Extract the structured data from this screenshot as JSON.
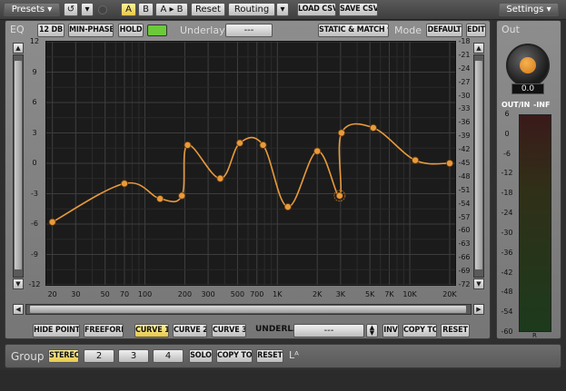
{
  "topbar": {
    "presets_label": "Presets",
    "a_label": "A",
    "b_label": "B",
    "ab_label": "A ▸ B",
    "reset_label": "Reset",
    "routing_label": "Routing",
    "load_csv_label": "LOAD CSV",
    "save_csv_label": "SAVE CSV",
    "settings_label": "Settings"
  },
  "eq": {
    "section_label": "EQ",
    "range_label": "12 DB",
    "min_phase_label": "MIN-PHASE",
    "hold_label": "HOLD",
    "underlay_label": "Underlay",
    "underlay_value": "---",
    "static_match_label": "STATIC & MATCH",
    "mode_label": "Mode",
    "default_label": "DEFAULT",
    "edit_label": "EDIT",
    "accent_color": "#e89a3c",
    "led_color": "#6cc93a"
  },
  "chart_data": {
    "type": "line",
    "x_scale": "log",
    "xlim": [
      18,
      22000
    ],
    "ylim": [
      -12,
      12
    ],
    "right_ylim": [
      -72,
      -18
    ],
    "x_ticks": [
      20,
      30,
      50,
      70,
      100,
      200,
      300,
      500,
      700,
      1000,
      2000,
      3000,
      5000,
      7000,
      10000,
      20000
    ],
    "x_tick_labels": [
      "20",
      "30",
      "50",
      "70",
      "100",
      "200",
      "300",
      "500",
      "700",
      "1K",
      "2K",
      "3K",
      "5K",
      "7K",
      "10K",
      "20K"
    ],
    "left_ticks": [
      12,
      9,
      6,
      3,
      0,
      -3,
      -6,
      -9,
      -12
    ],
    "right_ticks": [
      -18,
      -21,
      -24,
      -27,
      -30,
      -33,
      -36,
      -39,
      -42,
      -45,
      -48,
      -51,
      -54,
      -57,
      -60,
      -63,
      -66,
      -69,
      -72
    ],
    "grid": true,
    "points": [
      {
        "x": 20,
        "y": -5.8
      },
      {
        "x": 70,
        "y": -2.0
      },
      {
        "x": 130,
        "y": -3.5
      },
      {
        "x": 190,
        "y": -3.2
      },
      {
        "x": 210,
        "y": 1.8
      },
      {
        "x": 370,
        "y": -1.5
      },
      {
        "x": 520,
        "y": 2.0
      },
      {
        "x": 780,
        "y": 1.8
      },
      {
        "x": 1200,
        "y": -4.3
      },
      {
        "x": 2000,
        "y": 1.2
      },
      {
        "x": 2950,
        "y": -3.2
      },
      {
        "x": 3050,
        "y": 3.0
      },
      {
        "x": 5300,
        "y": 3.5
      },
      {
        "x": 11000,
        "y": 0.3
      },
      {
        "x": 20000,
        "y": 0.0
      }
    ]
  },
  "curve_controls": {
    "hide_points_label": "HIDE POINTS",
    "freeform_label": "FREEFORM",
    "curve1_label": "CURVE 1",
    "curve2_label": "CURVE 2",
    "curve3_label": "CURVE 3",
    "underlay_label": "UNDERLAY",
    "underlay_value": "---",
    "inv_label": "INV",
    "copy_to_label": "COPY TO",
    "reset_label": "RESET"
  },
  "out": {
    "section_label": "Out",
    "knob_value": "0.0",
    "outin_label": "OUT/IN",
    "inf_label": "-INF",
    "meter_ticks": [
      "6",
      "0",
      "-6",
      "-12",
      "-18",
      "-24",
      "-30",
      "-36",
      "-42",
      "-48",
      "-54",
      "-60"
    ],
    "meter_channel": "R"
  },
  "group": {
    "label": "Group",
    "stereo_label": "STEREO",
    "g2_label": "2",
    "g3_label": "3",
    "g4_label": "4",
    "solo_label": "SOLO",
    "copy_to_label": "COPY TO",
    "reset_label": "RESET",
    "la_label": "Lᴬ"
  }
}
